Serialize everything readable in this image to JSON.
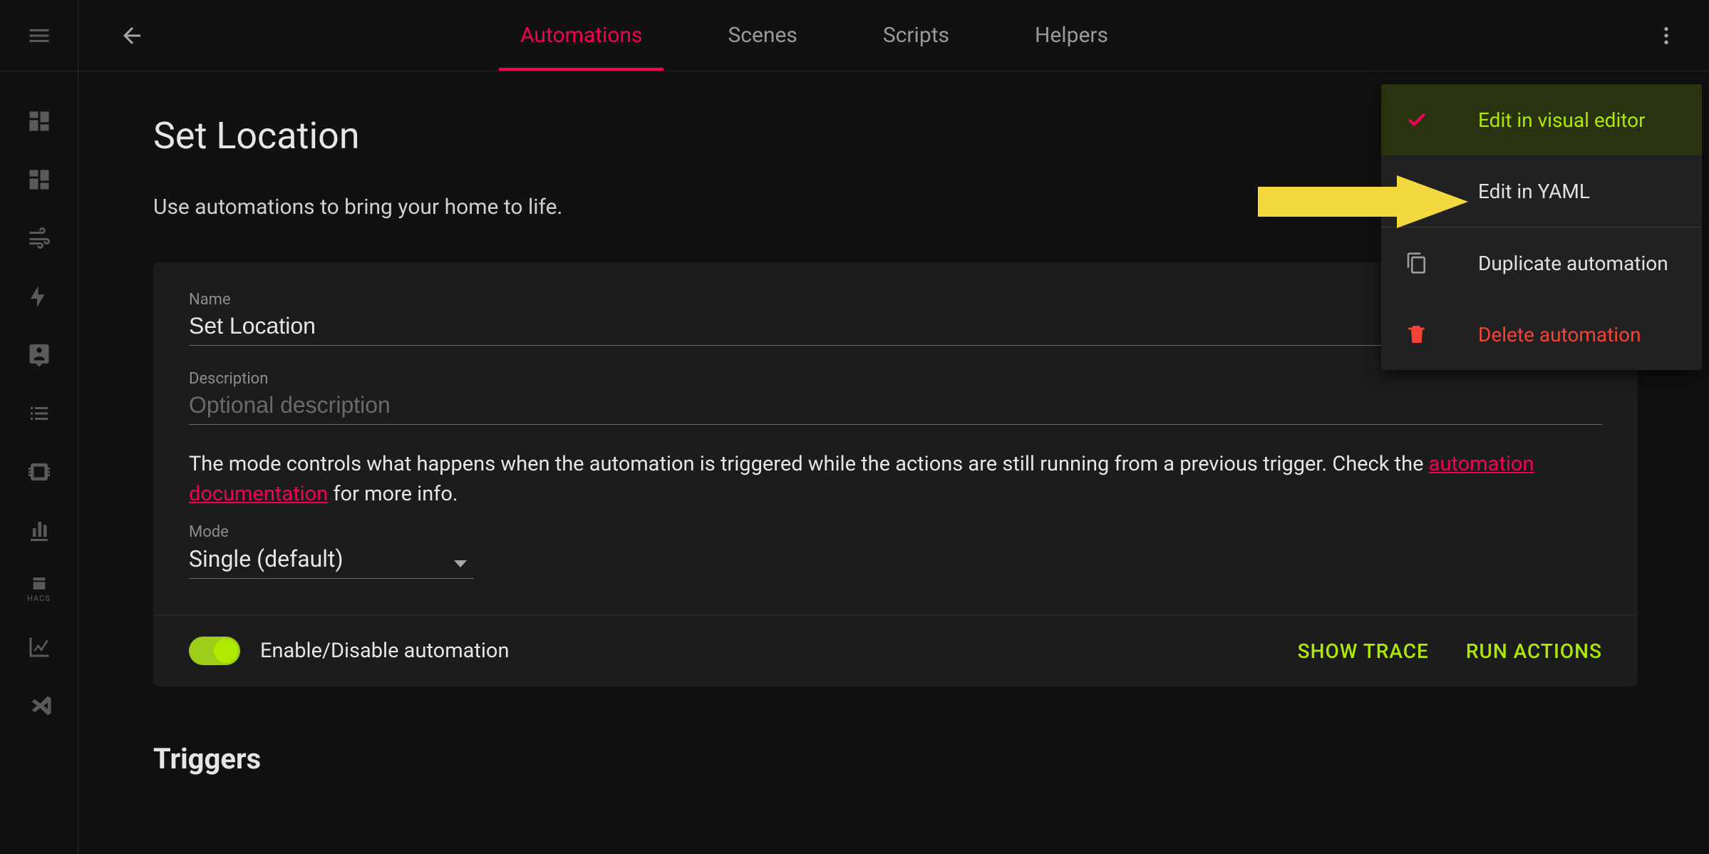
{
  "tabs": {
    "automations": "Automations",
    "scenes": "Scenes",
    "scripts": "Scripts",
    "helpers": "Helpers"
  },
  "page": {
    "title": "Set Location",
    "subtitle": "Use automations to bring your home to life.",
    "triggers_heading": "Triggers"
  },
  "card": {
    "name_label": "Name",
    "name_value": "Set Location",
    "description_label": "Description",
    "description_placeholder": "Optional description",
    "description_value": "",
    "mode_text_pre": "The mode controls what happens when the automation is triggered while the actions are still running from a previous trigger. Check the ",
    "mode_link": "automation documentation",
    "mode_text_post": " for more info.",
    "mode_label": "Mode",
    "mode_value": "Single (default)",
    "toggle_label": "Enable/Disable automation",
    "show_trace": "SHOW TRACE",
    "run_actions": "RUN ACTIONS"
  },
  "menu": {
    "visual": "Edit in visual editor",
    "yaml": "Edit in YAML",
    "duplicate": "Duplicate automation",
    "delete": "Delete automation"
  },
  "sidebar": {
    "hacs": "HACS"
  }
}
